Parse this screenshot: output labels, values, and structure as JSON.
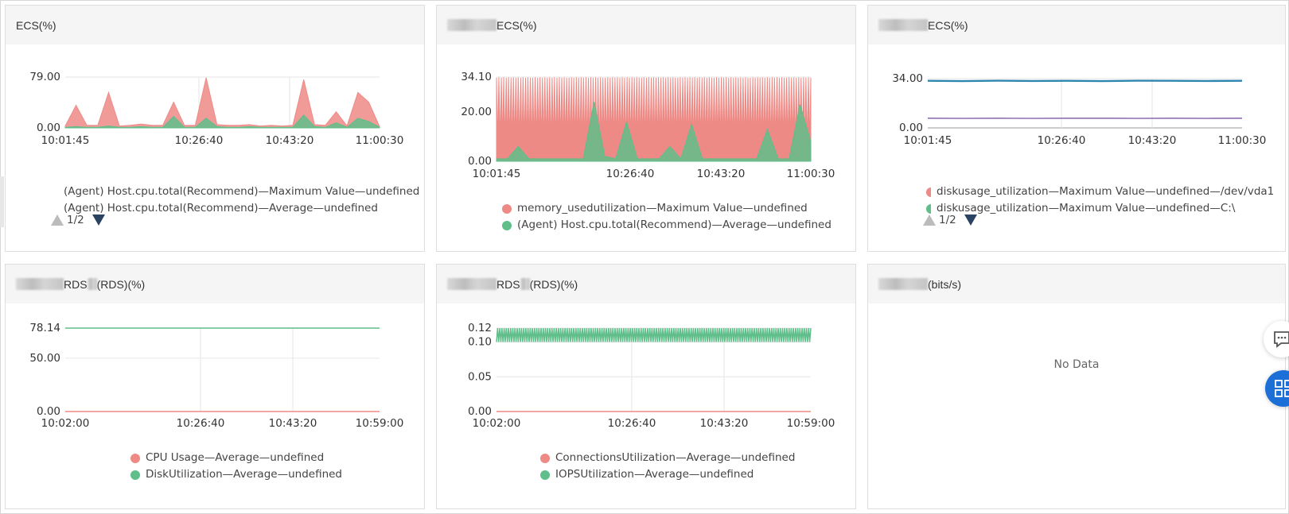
{
  "colors": {
    "red": "#ee8a86",
    "green": "#5fbe8a",
    "blue": "#2e86b0",
    "purple": "#8e6fae",
    "grid": "#e6e6e6"
  },
  "panels": [
    {
      "title_suffix": "ECS(%)",
      "ticks_y": [
        "79.00",
        "0.00"
      ],
      "ticks_x": [
        "10:01:45",
        "10:26:40",
        "10:43:20",
        "11:00:30"
      ],
      "legend": [
        "(Agent) Host.cpu.total(Recommend)—Maximum Value—undefined",
        "(Agent) Host.cpu.total(Recommend)—Average—undefined"
      ],
      "pager": "1/2"
    },
    {
      "title_suffix": "ECS(%)",
      "ticks_y": [
        "34.10",
        "20.00",
        "0.00"
      ],
      "ticks_x": [
        "10:01:45",
        "10:26:40",
        "10:43:20",
        "11:00:30"
      ],
      "legend": [
        "memory_usedutilization—Maximum Value—undefined",
        "(Agent) Host.cpu.total(Recommend)—Average—undefined"
      ]
    },
    {
      "title_suffix": "ECS(%)",
      "ticks_y": [
        "34.00",
        "0.00"
      ],
      "ticks_x": [
        "10:01:45",
        "10:26:40",
        "10:43:20",
        "11:00:30"
      ],
      "legend": [
        "diskusage_utilization—Maximum Value—undefined—/dev/vda1",
        "diskusage_utilization—Maximum Value—undefined—C:\\"
      ],
      "pager": "1/2"
    },
    {
      "title_mid": "RDS",
      "title_suffix": "(RDS)(%)",
      "ticks_y": [
        "78.14",
        "50.00",
        "0.00"
      ],
      "ticks_x": [
        "10:02:00",
        "10:26:40",
        "10:43:20",
        "10:59:00"
      ],
      "legend": [
        "CPU Usage—Average—undefined",
        "DiskUtilization—Average—undefined"
      ]
    },
    {
      "title_mid": "RDS",
      "title_suffix": "(RDS)(%)",
      "ticks_y": [
        "0.12",
        "0.10",
        "0.05",
        "0.00"
      ],
      "ticks_x": [
        "10:02:00",
        "10:26:40",
        "10:43:20",
        "10:59:00"
      ],
      "legend": [
        "ConnectionsUtilization—Average—undefined",
        "IOPSUtilization—Average—undefined"
      ]
    },
    {
      "title_suffix": "(bits/s)",
      "no_data": "No Data"
    }
  ],
  "chart_data": [
    {
      "type": "line",
      "x": [
        "10:01:45",
        "10:26:40",
        "10:43:20",
        "11:00:30"
      ],
      "ylim": [
        0,
        79
      ],
      "series": [
        {
          "name": "(Agent) Host.cpu.total(Recommend)—Maximum Value—undefined",
          "values": [
            3,
            35,
            4,
            4,
            55,
            3,
            4,
            6,
            4,
            4,
            40,
            4,
            4,
            78,
            5,
            4,
            4,
            5,
            3,
            4,
            3,
            4,
            75,
            5,
            4,
            25,
            3,
            55,
            40,
            2
          ]
        },
        {
          "name": "(Agent) Host.cpu.total(Recommend)—Average—undefined",
          "values": [
            1,
            2,
            1,
            1,
            3,
            1,
            1,
            2,
            1,
            1,
            18,
            1,
            1,
            15,
            2,
            1,
            1,
            2,
            1,
            1,
            1,
            1,
            20,
            2,
            1,
            8,
            1,
            15,
            10,
            1
          ]
        }
      ]
    },
    {
      "type": "area",
      "x": [
        "10:01:45",
        "10:26:40",
        "10:43:20",
        "11:00:30"
      ],
      "ylim": [
        0,
        34.1
      ],
      "series": [
        {
          "name": "memory_usedutilization—Maximum Value—undefined",
          "values": [
            33.8,
            7,
            34,
            7,
            33.8,
            7.5,
            34,
            7,
            33.8,
            7,
            34,
            7,
            33.8,
            7,
            34,
            7,
            33.8,
            7,
            34,
            7,
            33.8,
            7,
            34,
            7,
            33.8,
            7,
            34,
            7,
            33.8,
            7
          ]
        },
        {
          "name": "(Agent) Host.cpu.total(Recommend)—Average—undefined",
          "values": [
            1,
            1,
            6,
            1,
            1,
            1,
            1,
            1,
            1,
            24,
            2,
            1,
            16,
            1,
            1,
            1,
            6,
            1,
            15,
            1,
            1,
            1,
            1,
            1,
            1,
            13,
            1,
            1,
            23,
            8
          ]
        }
      ]
    },
    {
      "type": "line",
      "x": [
        "10:01:45",
        "10:26:40",
        "10:43:20",
        "11:00:30"
      ],
      "ylim": [
        0,
        34
      ],
      "series": [
        {
          "name": "diskusage_utilization—Maximum Value—undefined—/dev/vda1",
          "values": [
            32.5,
            32.3,
            32.6,
            32.4,
            32.5,
            32.3,
            32.6,
            32.5,
            32.4,
            32.5
          ]
        },
        {
          "name": "diskusage_utilization—Maximum Value—undefined—C:\\",
          "values": [
            6.7,
            6.6,
            6.7,
            6.6,
            6.7,
            6.7,
            6.6,
            6.7,
            6.6,
            6.7
          ]
        }
      ]
    },
    {
      "type": "line",
      "x": [
        "10:02:00",
        "10:26:40",
        "10:43:20",
        "10:59:00"
      ],
      "ylim": [
        0,
        78.14
      ],
      "series": [
        {
          "name": "CPU Usage—Average—undefined",
          "values": [
            0,
            0,
            0,
            0,
            0,
            0
          ]
        },
        {
          "name": "DiskUtilization—Average—undefined",
          "values": [
            78.14,
            78.14,
            78.14,
            78.14,
            78.14,
            78.14
          ]
        }
      ]
    },
    {
      "type": "line",
      "x": [
        "10:02:00",
        "10:26:40",
        "10:43:20",
        "10:59:00"
      ],
      "ylim": [
        0,
        0.12
      ],
      "series": [
        {
          "name": "ConnectionsUtilization—Average—undefined",
          "values": [
            0,
            0,
            0,
            0,
            0,
            0
          ]
        },
        {
          "name": "IOPSUtilization—Average—undefined",
          "values": [
            0.1,
            0.12,
            0.1,
            0.12,
            0.1,
            0.12,
            0.1,
            0.12,
            0.1,
            0.12,
            0.1,
            0.12,
            0.1,
            0.12,
            0.1,
            0.12,
            0.1,
            0.12,
            0.1,
            0.12,
            0.1,
            0.12,
            0.1,
            0.12,
            0.1,
            0.12,
            0.1,
            0.12,
            0.1,
            0.12,
            0.1,
            0.12,
            0.1,
            0.12,
            0.1,
            0.12,
            0.1,
            0.12,
            0.1,
            0.12,
            0.1,
            0.12,
            0.1,
            0.12,
            0.1,
            0.12,
            0.1,
            0.12,
            0.1,
            0.12,
            0.1,
            0.12,
            0.1,
            0.12,
            0.1,
            0.12,
            0.1,
            0.12,
            0.1,
            0.12,
            0.1,
            0.12,
            0.1,
            0.12,
            0.1,
            0.12,
            0.1,
            0.12,
            0.1,
            0.12,
            0.1,
            0.12,
            0.1,
            0.12,
            0.1,
            0.12,
            0.1,
            0.12,
            0.1,
            0.12,
            0.1,
            0.12,
            0.1,
            0.12,
            0.1,
            0.12,
            0.1,
            0.12,
            0.1,
            0.12,
            0.1,
            0.12,
            0.1,
            0.12,
            0.1,
            0.12,
            0.1,
            0.12,
            0.1,
            0.12,
            0.1,
            0.12,
            0.1,
            0.12,
            0.1,
            0.12,
            0.1,
            0.12,
            0.1,
            0.12,
            0.1,
            0.12,
            0.1,
            0.12,
            0.1,
            0.12,
            0.1,
            0.12,
            0.1,
            0.12,
            0.1,
            0.12,
            0.1,
            0.12,
            0.1,
            0.12,
            0.1,
            0.12,
            0.1,
            0.12,
            0.1,
            0.12,
            0.1,
            0.12,
            0.1,
            0.12,
            0.1,
            0.12,
            0.1,
            0.12,
            0.1,
            0.12,
            0.1,
            0.12,
            0.1,
            0.12,
            0.1,
            0.12,
            0.1,
            0.12,
            0.1,
            0.12,
            0.1,
            0.12,
            0.1,
            0.12,
            0.1,
            0.12,
            0.1,
            0.12,
            0.1,
            0.12,
            0.1,
            0.12,
            0.1,
            0.12,
            0.1,
            0.12,
            0.1,
            0.12,
            0.1,
            0.12,
            0.1,
            0.12,
            0.1,
            0.12,
            0.1,
            0.12,
            0.1,
            0.12,
            0.1,
            0.12,
            0.1,
            0.12,
            0.1,
            0.12,
            0.1,
            0.12,
            0.1,
            0.12,
            0.1,
            0.12,
            0.1,
            0.12,
            0.1,
            0.12,
            0.1,
            0.12,
            0.1,
            0.12,
            0.1,
            0.12,
            0.1,
            0.12,
            0.1,
            0.12,
            0.1,
            0.12,
            0.1,
            0.12,
            0.1,
            0.12,
            0.1,
            0.12,
            0.1,
            0.12,
            0.1,
            0.12,
            0.1,
            0.12,
            0.1,
            0.12,
            0.1,
            0.12,
            0.1,
            0.12,
            0.1,
            0.12,
            0.1,
            0.12,
            0.1,
            0.12,
            0.1,
            0.12,
            0.1,
            0.12,
            0.1,
            0.12,
            0.1,
            0.12,
            0.1,
            0.12,
            0.1,
            0.12,
            0.1,
            0.12,
            0.1,
            0.12,
            0.1,
            0.12,
            0.1,
            0.12,
            0.1,
            0.12,
            0.1,
            0.12,
            0.1,
            0.12,
            0.1,
            0.12,
            0.1,
            0.12,
            0.1,
            0.12,
            0.1,
            0.12,
            0.1,
            0.12,
            0.1,
            0.12,
            0.1,
            0.12,
            0.1,
            0.12,
            0.1,
            0.12,
            0.1,
            0.12,
            0.1,
            0.12,
            0.1,
            0.12,
            0.1,
            0.12,
            0.1,
            0.12,
            0.1,
            0.12,
            0.1,
            0.12
          ]
        }
      ]
    }
  ]
}
